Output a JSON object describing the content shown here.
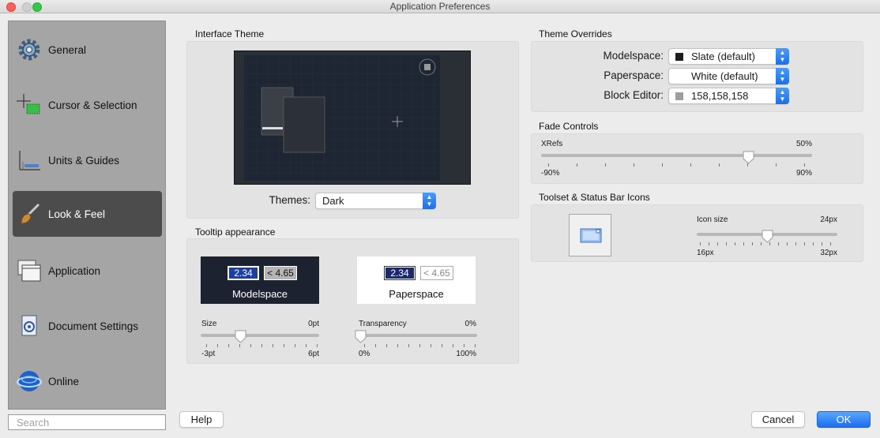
{
  "window": {
    "title": "Application Preferences"
  },
  "sidebar": {
    "items": [
      {
        "label": "General",
        "icon": "gear-icon"
      },
      {
        "label": "Cursor & Selection",
        "icon": "crosshair-icon"
      },
      {
        "label": "Units & Guides",
        "icon": "ruler-icon"
      },
      {
        "label": "Look & Feel",
        "icon": "brush-icon",
        "active": true
      },
      {
        "label": "Application",
        "icon": "windows-icon"
      },
      {
        "label": "Document Settings",
        "icon": "document-icon"
      },
      {
        "label": "Online",
        "icon": "globe-icon"
      }
    ],
    "search_placeholder": "Search"
  },
  "interface_theme": {
    "title": "Interface Theme",
    "themes_label": "Themes:",
    "theme_value": "Dark"
  },
  "tooltip": {
    "title": "Tooltip appearance",
    "model": {
      "value1": "2.34",
      "value2": "< 4.65",
      "label": "Modelspace"
    },
    "paper": {
      "value1": "2.34",
      "value2": "< 4.65",
      "label": "Paperspace"
    },
    "size": {
      "label": "Size",
      "value": "0pt",
      "min": "-3pt",
      "max": "6pt",
      "level": 0.33
    },
    "transparency": {
      "label": "Transparency",
      "value": "0%",
      "min": "0%",
      "max": "100%",
      "level": 0.0
    }
  },
  "overrides": {
    "title": "Theme Overrides",
    "rows": [
      {
        "label": "Modelspace:",
        "value": "Slate (default)",
        "swatch": "#1e1e1e"
      },
      {
        "label": "Paperspace:",
        "value": "White (default)",
        "swatch": ""
      },
      {
        "label": "Block Editor:",
        "value": "158,158,158",
        "swatch": "#9e9e9e"
      }
    ]
  },
  "fade": {
    "title": "Fade Controls",
    "xrefs_label": "XRefs",
    "xrefs_value": "50%",
    "min": "-90%",
    "max": "90%",
    "level": 0.78
  },
  "toolset": {
    "title": "Toolset & Status Bar Icons",
    "icon_size_label": "Icon size",
    "icon_size_value": "24px",
    "min": "16px",
    "max": "32px",
    "level": 0.5
  },
  "buttons": {
    "help": "Help",
    "cancel": "Cancel",
    "ok": "OK"
  },
  "colors": {
    "accent": "#1d6fe6",
    "sidebar_active": "#4c4c4c",
    "tooltip_dark": "#1c2230"
  }
}
